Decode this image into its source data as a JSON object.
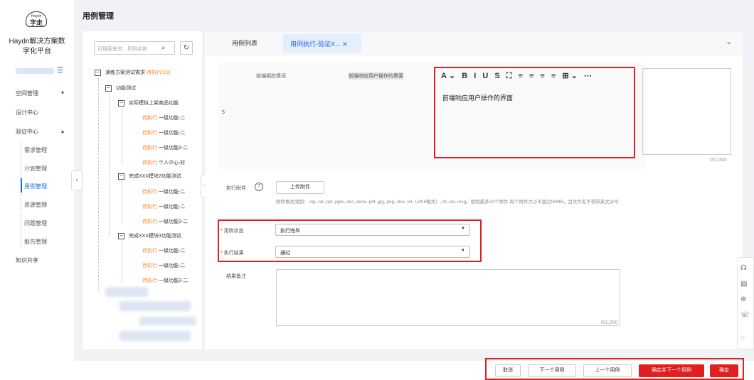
{
  "brand": {
    "logo_small": "Haydn",
    "logo_main": "字走",
    "name_line1": "Haydn解决方案数",
    "name_line2": "字化平台"
  },
  "sidebar": {
    "items": [
      {
        "label": "空间管理",
        "arrow": "▾"
      },
      {
        "label": "设计中心"
      },
      {
        "label": "验证中心",
        "arrow": "▴"
      },
      {
        "label": "知识共享"
      }
    ],
    "sub_items": [
      "需求管理",
      "计划管理",
      "用例管理",
      "资源管理",
      "问题管理",
      "报告管理"
    ],
    "active": "用例管理"
  },
  "page": {
    "title": "用例管理"
  },
  "tree": {
    "search_placeholder": "可搜索需求、用例名称",
    "root_label": "演练方案测试需求",
    "root_badge": "待执行(13)",
    "l1": "功能测试",
    "groups": [
      "实际模拟上架商品功能",
      "完成XXX模块2功能测试",
      "完成XXX模块3功能测试"
    ],
    "pending": "待执行",
    "g1_cases": [
      "一级功能-二",
      "一级功能-二",
      "一级功能2-二",
      "个人中心-好"
    ],
    "g2_cases": [
      "一级功能-二",
      "一级功能-二",
      "一级功能2-二"
    ],
    "g3_cases": [
      "一级功能-二",
      "一级功能-二",
      "一级功能2-二"
    ]
  },
  "tabs": {
    "list": "用例列表",
    "exec": "用例执行-验证X...",
    "close": "✕",
    "chevron": "⌄"
  },
  "step": {
    "index": "5",
    "precondition_label": "前端相应情况",
    "expected": "前端响应用户操作的界面",
    "editor_text": "前端响应用户操作的界面",
    "toolbar": "A⌄ B I U S ⛶ ≡ ≡ ≡ ≡ ⊞⌄ ⋯",
    "side_count": "0/2,000"
  },
  "form": {
    "attach_label": "执行附件",
    "help_icon": "?",
    "upload_btn": "上传附件",
    "hint": "附件格式限制：.zip,.rar,.ppt,.pptx,.doc,.docx,.pdf,.jpg,.png,.xlsx,.txt（utf-8格式）,.trf,.xls,.msg。限制最多20个附件,每个附件大小不超过50MB，且文件名不得带英文分号",
    "status_label": "用例状态",
    "status_value": "执行完毕",
    "result_label": "执行结果",
    "result_value": "通过",
    "note_label": "结果备注",
    "note_count": "0/1,000",
    "required_mark": "*"
  },
  "buttons": {
    "cancel": "取消",
    "next": "下一个用例",
    "prev": "上一个用例",
    "confirm_next": "确定并下一个用例",
    "confirm": "确定"
  },
  "colors": {
    "accent": "#1e6be0",
    "danger": "#e02020",
    "pending": "#f08a24"
  }
}
